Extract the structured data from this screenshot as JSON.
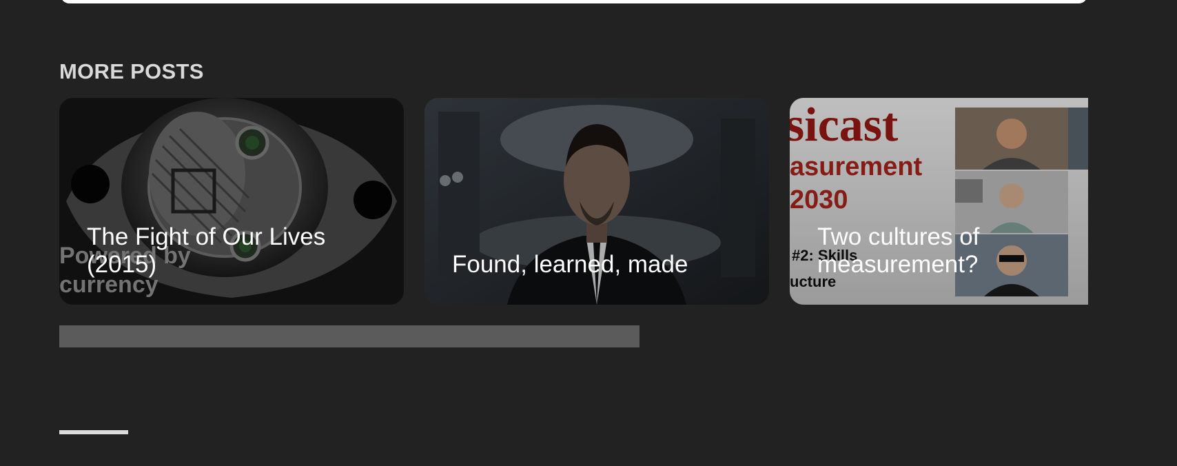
{
  "section": {
    "title": "MORE POSTS"
  },
  "posts": [
    {
      "title": "The Fight of Our Lives (2015)",
      "image": "sensor-chip-photo",
      "image_text": [
        "Powered by",
        "currency"
      ]
    },
    {
      "title": "Found, learned, made",
      "image": "man-in-suit-photo"
    },
    {
      "title": "Two cultures of measurement?",
      "image": "video-call-slide",
      "image_text": [
        "sicast",
        "asurement",
        "2030",
        "#2: Skills",
        "ucture"
      ]
    }
  ],
  "colors": {
    "background": "#222222",
    "heading": "#d9d9d9",
    "scrollbar": "#5b5b5b"
  }
}
